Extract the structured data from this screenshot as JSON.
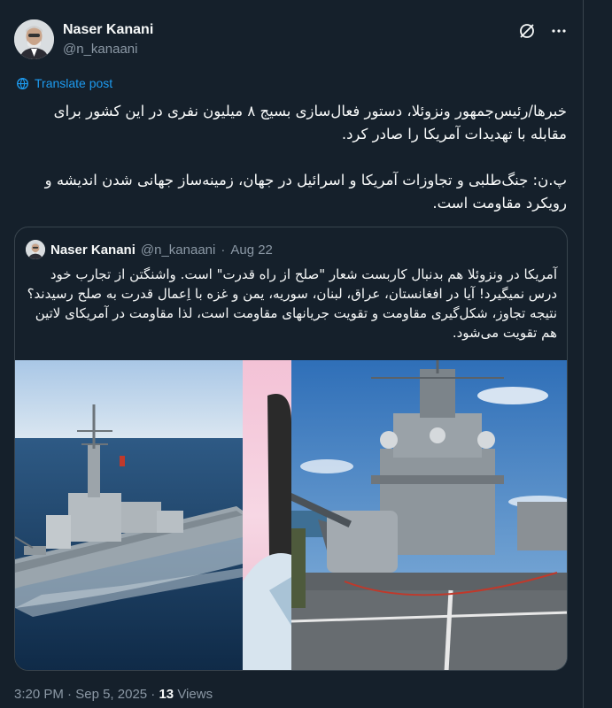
{
  "author": {
    "display_name": "Naser Kanani",
    "handle": "@n_kanaani"
  },
  "header": {
    "grok_icon": "slash-circle-icon",
    "more_icon": "more-dots-icon"
  },
  "translate": {
    "label": "Translate post",
    "icon": "globe-icon"
  },
  "tweet": {
    "paragraph_1": "خبرها/رئیس‌جمهور ونزوئلا، دستور فعال‌سازی بسیج ۸ میلیون نفری در این کشور برای مقابله با تهدیدات آمریکا را صادر کرد.",
    "paragraph_2": "پ.ن: جنگ‌طلبی و تجاوزات آمریکا و اسرائیل در جهان، زمینه‌ساز جهانی شدن اندیشه و رویکرد مقاومت است."
  },
  "quote": {
    "display_name": "Naser Kanani",
    "handle": "@n_kanaani",
    "separator": "·",
    "date": "Aug 22",
    "text": "آمریکا در ونزوئلا هم بدنبال کاربست شعار \"صلح از راه قدرت\" است. واشنگتن از تجارب خود درس نمیگیرد! آیا در افغانستان، عراق، لبنان، سوریه، یمن و غزه با اِعمال قدرت به صلح رسیدند؟ نتیجه تجاوز، شکل‌گیری مقاومت و تقویت جریانهای مقاومت است، لذا مقاومت در آمریکای لاتین هم تقویت می‌شود."
  },
  "footer": {
    "time": "3:20 PM",
    "dot1": "·",
    "date": "Sep 5, 2025",
    "dot2": "·",
    "views_count": "13",
    "views_label": "Views"
  },
  "colors": {
    "background": "#15202b",
    "accent": "#1d9bf0",
    "border": "#38444d",
    "secondary_text": "#8b98a5"
  }
}
